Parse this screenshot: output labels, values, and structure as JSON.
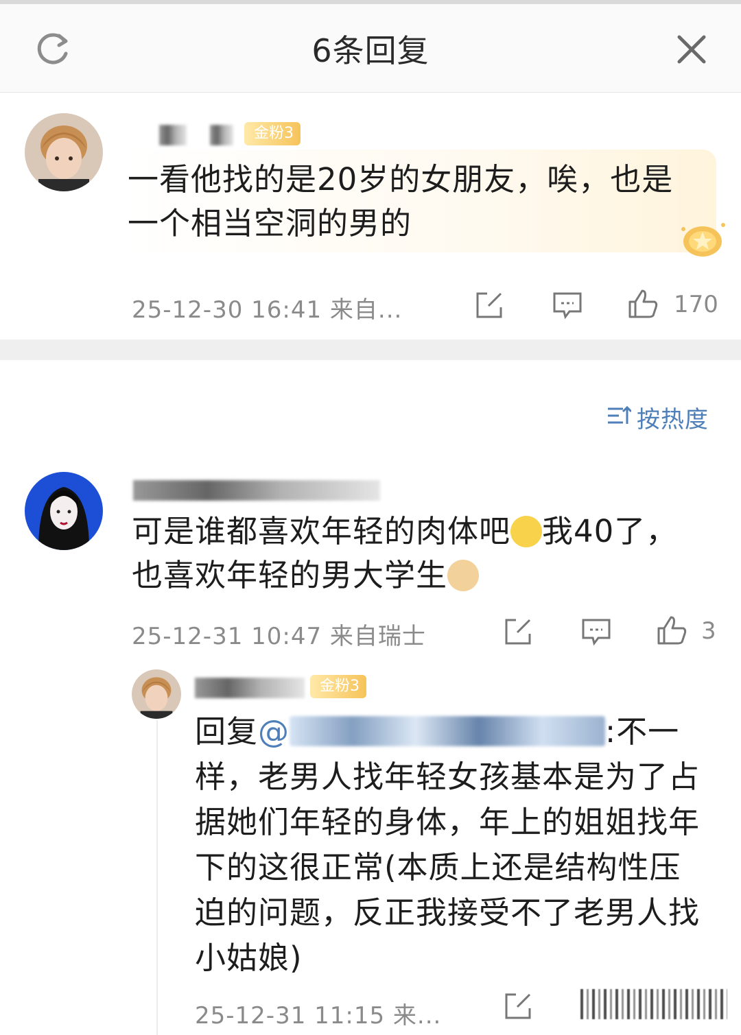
{
  "header": {
    "title": "6条回复"
  },
  "main_comment": {
    "badge": "金粉3",
    "text": "一看他找的是20岁的女朋友，唉，也是一个相当空洞的男的",
    "meta": "25-12-30 16:41 来自...",
    "likes": "170"
  },
  "sort": {
    "label": "按热度"
  },
  "replies": [
    {
      "text_part1": "可是谁都喜欢年轻的肉体吧",
      "text_part2": "我40了，也喜欢年轻的男大学生",
      "meta": "25-12-31 10:47 来自瑞士",
      "likes": "3"
    },
    {
      "badge": "金粉3",
      "reply_prefix": "回复",
      "at": "@",
      "text": ":不一样，老男人找年轻女孩基本是为了占据她们年轻的身体，年上的姐姐找年下的这很正常(本质上还是结构性压迫的问题，反正我接受不了老男人找小姑娘)",
      "meta": "25-12-31 11:15 来..."
    }
  ],
  "colors": {
    "link": "#4f7fb8",
    "meta": "#8a8a8a",
    "badge": "#f6c35a",
    "divider": "#efefef"
  },
  "icons": [
    "refresh-icon",
    "close-icon",
    "repost-icon",
    "comment-icon",
    "like-icon",
    "sort-icon",
    "crown-icon"
  ]
}
